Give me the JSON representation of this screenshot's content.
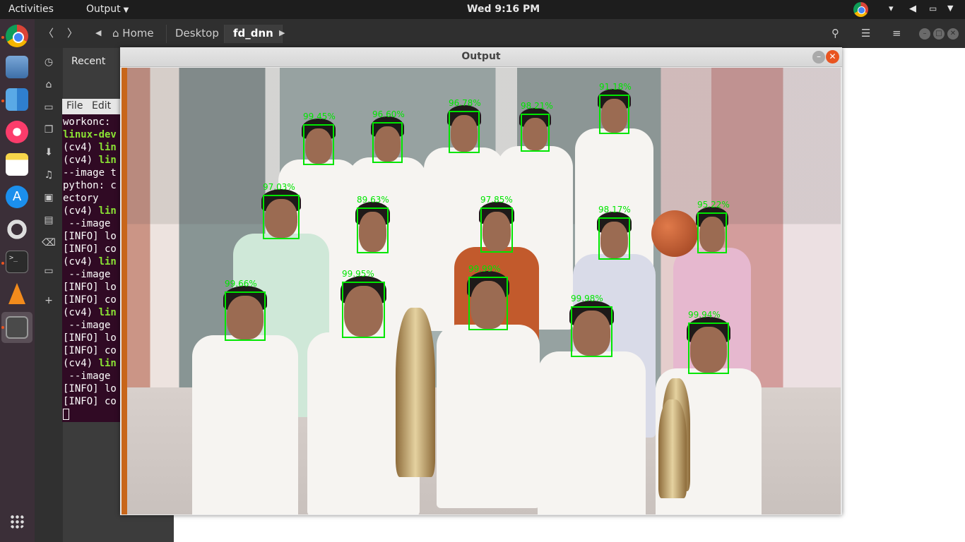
{
  "topbar": {
    "activities": "Activities",
    "app_menu": "Output",
    "clock": "Wed  9:16 PM"
  },
  "files": {
    "breadcrumb": [
      "Home",
      "Desktop",
      "fd_dnn"
    ],
    "sidebar_label": "Recent"
  },
  "terminal": {
    "menu": [
      "File",
      "Edit"
    ],
    "lines": [
      {
        "text": "workonc:",
        "style": "normal"
      },
      {
        "text": "linux-dev",
        "style": "green"
      },
      {
        "text": "(cv4) lin",
        "style": "mixed"
      },
      {
        "text": "(cv4) lin",
        "style": "mixed"
      },
      {
        "text": "--image t",
        "style": "normal"
      },
      {
        "text": "python: c",
        "style": "normal"
      },
      {
        "text": "ectory",
        "style": "normal"
      },
      {
        "text": "(cv4) lin",
        "style": "mixed"
      },
      {
        "text": " --image",
        "style": "normal"
      },
      {
        "text": "[INFO] lo",
        "style": "normal"
      },
      {
        "text": "[INFO] co",
        "style": "normal"
      },
      {
        "text": "(cv4) lin",
        "style": "mixed"
      },
      {
        "text": " --image",
        "style": "normal"
      },
      {
        "text": "[INFO] lo",
        "style": "normal"
      },
      {
        "text": "[INFO] co",
        "style": "normal"
      },
      {
        "text": "(cv4) lin",
        "style": "mixed"
      },
      {
        "text": " --image",
        "style": "normal"
      },
      {
        "text": "[INFO] lo",
        "style": "normal"
      },
      {
        "text": "[INFO] co",
        "style": "normal"
      },
      {
        "text": "(cv4) lin",
        "style": "mixed"
      },
      {
        "text": " --image",
        "style": "normal"
      },
      {
        "text": "[INFO] lo",
        "style": "normal"
      },
      {
        "text": "[INFO] co",
        "style": "normal"
      }
    ]
  },
  "output_window": {
    "title": "Output",
    "detections": [
      {
        "label": "99.45%"
      },
      {
        "label": "96.60%"
      },
      {
        "label": "96.78%"
      },
      {
        "label": "98.21%"
      },
      {
        "label": "91.18%"
      },
      {
        "label": "97.03%"
      },
      {
        "label": "89.63%"
      },
      {
        "label": "97.85%"
      },
      {
        "label": "98.17%"
      },
      {
        "label": "95.22%"
      },
      {
        "label": "99.66%"
      },
      {
        "label": "99.95%"
      },
      {
        "label": "99.99%"
      },
      {
        "label": "99.98%"
      },
      {
        "label": "99.94%"
      }
    ],
    "box_color": "#00e600"
  },
  "dock": {
    "apps": [
      "chrome-icon",
      "image-viewer-icon",
      "finder-icon",
      "music-icon",
      "notes-icon",
      "app-store-icon",
      "help-icon",
      "terminal-icon",
      "vlc-icon",
      "output-window-icon",
      "show-apps-icon"
    ],
    "accent_color": "#e95420"
  }
}
